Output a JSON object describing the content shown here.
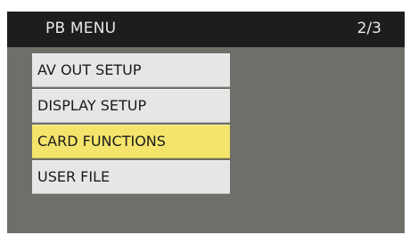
{
  "header": {
    "title": "PB MENU",
    "page": "2/3"
  },
  "menu": {
    "items": [
      {
        "label": "AV OUT SETUP",
        "selected": false
      },
      {
        "label": "DISPLAY SETUP",
        "selected": false
      },
      {
        "label": "CARD FUNCTIONS",
        "selected": true
      },
      {
        "label": "USER FILE",
        "selected": false
      }
    ]
  },
  "colors": {
    "screen_background": "#6e6f68",
    "header_background": "#1d1d1d",
    "item_background": "#e6e6e6",
    "selected_background": "#f4e46c"
  }
}
